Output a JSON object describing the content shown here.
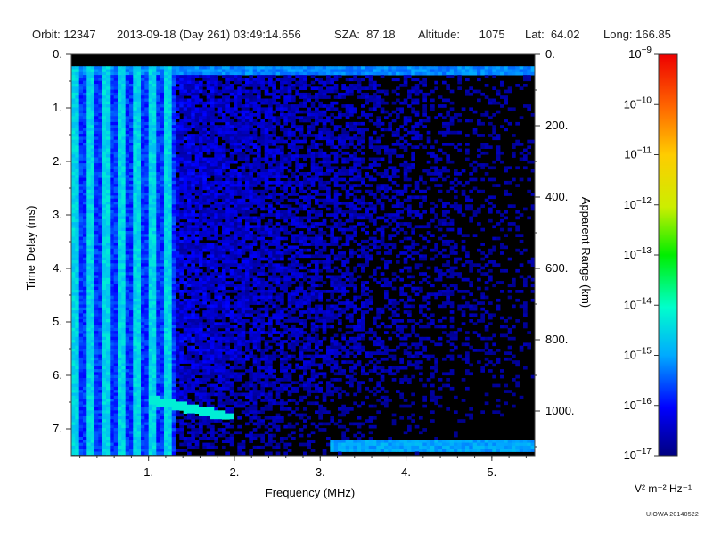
{
  "header": {
    "orbit": "Orbit: 12347",
    "datetime": "2013-09-18 (Day 261) 03:49:14.656",
    "sza": "SZA:  87.18",
    "altitude": "Altitude:      1075",
    "lat": "Lat:  64.02",
    "long": "Long: 166.85"
  },
  "footer": {
    "credit": "UIOWA 20140522"
  },
  "chart_data": {
    "type": "heatmap",
    "title": "",
    "xlabel": "Frequency (MHz)",
    "ylabel": "Time Delay (ms)",
    "y2label": "Apparent Range (km)",
    "xlim": [
      0.1,
      5.5
    ],
    "ylim": [
      0,
      7.5
    ],
    "y2lim": [
      0,
      1125
    ],
    "x_ticks": [
      1,
      2,
      3,
      4,
      5
    ],
    "x_tick_labels": [
      "1.",
      "2.",
      "3.",
      "4.",
      "5."
    ],
    "y_ticks": [
      0,
      1,
      2,
      3,
      4,
      5,
      6,
      7
    ],
    "y_tick_labels": [
      "0.",
      "1.",
      "2.",
      "3.",
      "4.",
      "5.",
      "6.",
      "7."
    ],
    "y2_ticks": [
      0,
      200,
      400,
      600,
      800,
      1000
    ],
    "y2_tick_labels": [
      "0.",
      "200.",
      "400.",
      "600.",
      "800.",
      "1000."
    ],
    "colorbar": {
      "label": "V² m⁻² Hz⁻¹",
      "scale": "log",
      "range_exp": [
        -17,
        -9
      ],
      "tick_exps": [
        -17,
        -16,
        -15,
        -14,
        -13,
        -12,
        -11,
        -10,
        -9
      ],
      "tick_base": "10",
      "colors": [
        "#000080",
        "#0000ff",
        "#00aaff",
        "#00ffcc",
        "#00ee00",
        "#ccee00",
        "#ffcc00",
        "#ff6600",
        "#ee0000"
      ]
    },
    "features": [
      {
        "name": "background-noise",
        "freq_range": [
          1.3,
          5.5
        ],
        "delay_range": [
          0.3,
          7.5
        ],
        "log_level": -16.3
      },
      {
        "name": "surface-band-top",
        "freq_range": [
          0.1,
          5.5
        ],
        "delay_range": [
          0.2,
          0.4
        ],
        "log_level": -15.2
      },
      {
        "name": "low-frequency-striations",
        "freq_range": [
          0.1,
          1.3
        ],
        "delay_range": [
          0.2,
          7.5
        ],
        "log_level": -14.5
      },
      {
        "name": "echo-trace",
        "freq_range": [
          1.0,
          2.0
        ],
        "delay_range": [
          6.4,
          6.8
        ],
        "log_level": -14.2
      },
      {
        "name": "bottom-band",
        "freq_range": [
          3.1,
          5.5
        ],
        "delay_range": [
          7.2,
          7.4
        ],
        "log_level": -15.0
      }
    ]
  }
}
